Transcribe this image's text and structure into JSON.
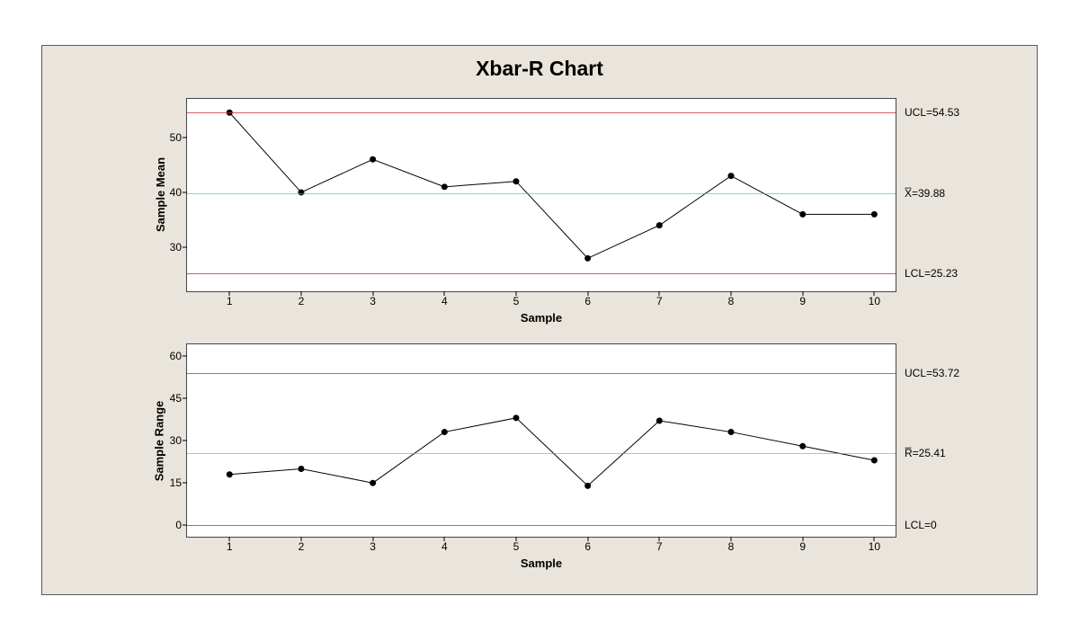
{
  "title": "Xbar-R Chart",
  "chart_data": [
    {
      "type": "line",
      "name": "xbar",
      "ylabel": "Sample Mean",
      "xlabel": "Sample",
      "x": [
        1,
        2,
        3,
        4,
        5,
        6,
        7,
        8,
        9,
        10
      ],
      "values": [
        54.5,
        40.0,
        46.0,
        41.0,
        42.0,
        28.0,
        34.0,
        43.0,
        36.0,
        36.0
      ],
      "y_ticks": [
        30,
        40,
        50
      ],
      "ylim": [
        22,
        57
      ],
      "ref_lines": {
        "ucl": {
          "value": 54.53,
          "label": "UCL=54.53",
          "color": "red"
        },
        "center": {
          "value": 39.88,
          "label": "X̅=39.88",
          "color": "green"
        },
        "lcl": {
          "value": 25.23,
          "label": "LCL=25.23",
          "color": "red"
        }
      }
    },
    {
      "type": "line",
      "name": "r",
      "ylabel": "Sample Range",
      "xlabel": "Sample",
      "x": [
        1,
        2,
        3,
        4,
        5,
        6,
        7,
        8,
        9,
        10
      ],
      "values": [
        18.0,
        20.0,
        15.0,
        33.0,
        38.0,
        14.0,
        37.0,
        33.0,
        28.0,
        23.0
      ],
      "y_ticks": [
        0,
        15,
        30,
        45,
        60
      ],
      "ylim": [
        -4,
        64
      ],
      "ref_lines": {
        "ucl": {
          "value": 53.72,
          "label": "UCL=53.72",
          "color": "red"
        },
        "center": {
          "value": 25.41,
          "label": "R̅=25.41",
          "color": "green"
        },
        "lcl": {
          "value": 0,
          "label": "LCL=0",
          "color": "red"
        }
      }
    }
  ]
}
